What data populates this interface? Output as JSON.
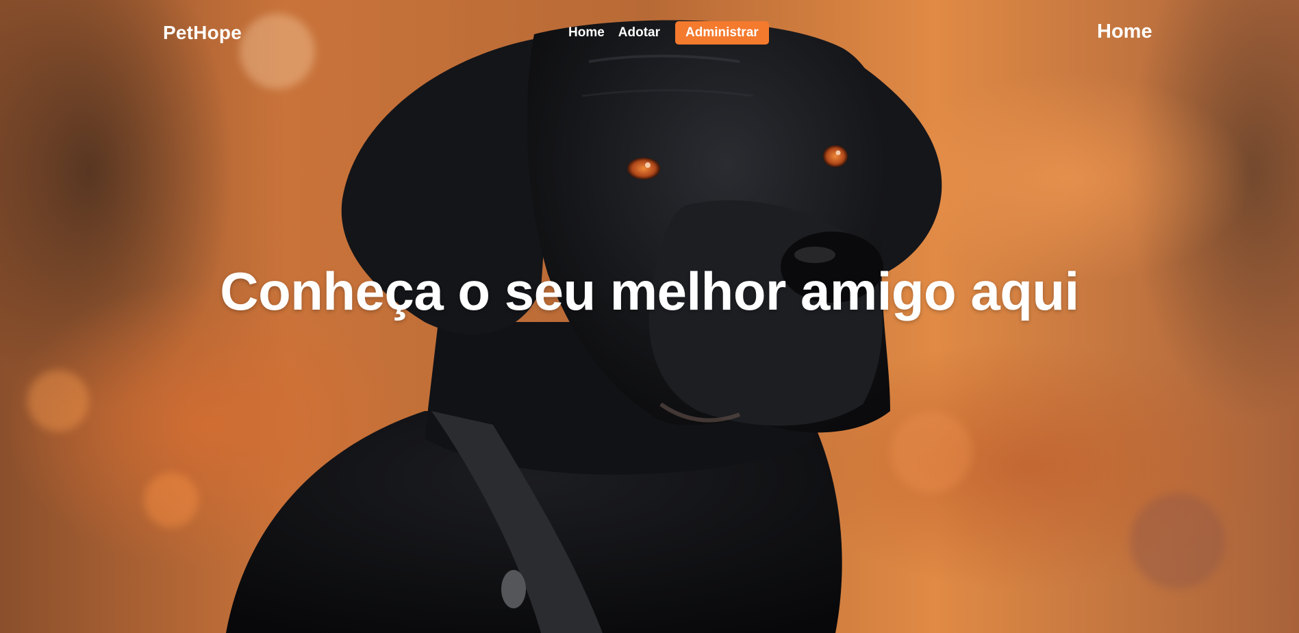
{
  "navbar": {
    "brand": "PetHope",
    "links": [
      "Home",
      "Adotar"
    ],
    "cta_label": "Administrar",
    "page_label": "Home"
  },
  "hero": {
    "headline": "Conheça o seu melhor amigo aqui",
    "image_subject": "black-dog-portrait"
  },
  "colors": {
    "accent": "#f47a2e",
    "text": "#ffffff"
  }
}
